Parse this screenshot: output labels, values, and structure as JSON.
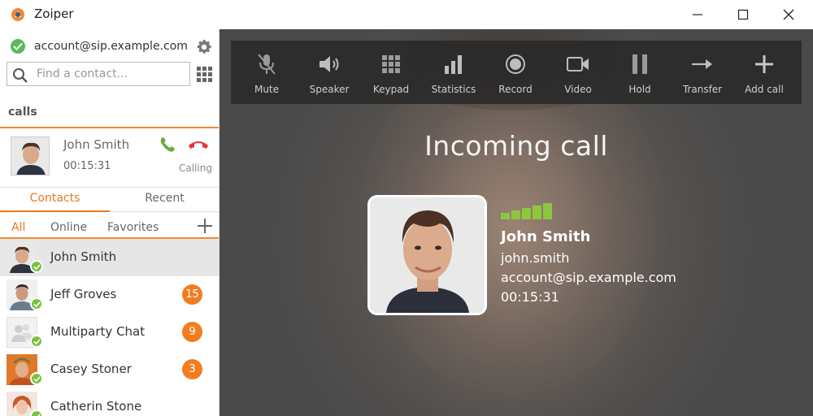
{
  "window": {
    "title": "Zoiper",
    "minimize_icon": "minimize-icon",
    "maximize_icon": "maximize-icon",
    "close_icon": "close-icon"
  },
  "account": {
    "name": "account@sip.example.com",
    "status": "online",
    "status_color": "#5cb85c"
  },
  "search": {
    "placeholder": "Find a contact..."
  },
  "calls_section": {
    "label": "calls",
    "active_call": {
      "name": "John Smith",
      "duration": "00:15:31",
      "status": "Calling"
    }
  },
  "tabs": [
    {
      "label": "Contacts",
      "active": true
    },
    {
      "label": "Recent",
      "active": false
    }
  ],
  "filters": [
    {
      "label": "All",
      "active": true
    },
    {
      "label": "Online",
      "active": false
    },
    {
      "label": "Favorites",
      "active": false
    }
  ],
  "contacts": [
    {
      "name": "John Smith",
      "badge": "",
      "selected": true
    },
    {
      "name": "Jeff Groves",
      "badge": "15",
      "selected": false
    },
    {
      "name": "Multiparty Chat",
      "badge": "9",
      "selected": false
    },
    {
      "name": "Casey Stoner",
      "badge": "3",
      "selected": false
    },
    {
      "name": "Catherin Stone",
      "badge": "",
      "selected": false
    }
  ],
  "toolbar": [
    {
      "label": "Mute",
      "icon": "mute-icon"
    },
    {
      "label": "Speaker",
      "icon": "speaker-icon"
    },
    {
      "label": "Keypad",
      "icon": "keypad-icon"
    },
    {
      "label": "Statistics",
      "icon": "statistics-icon"
    },
    {
      "label": "Record",
      "icon": "record-icon"
    },
    {
      "label": "Video",
      "icon": "video-icon"
    },
    {
      "label": "Hold",
      "icon": "hold-icon"
    },
    {
      "label": "Transfer",
      "icon": "transfer-icon"
    },
    {
      "label": "Add call",
      "icon": "add-call-icon"
    }
  ],
  "incoming": {
    "title": "Incoming call",
    "caller_name": "John Smith",
    "caller_user": "john.smith",
    "caller_account": "account@sip.example.com",
    "duration": "00:15:31",
    "signal_bars": 5,
    "signal_color": "#8dc63f"
  },
  "colors": {
    "accent": "#e87722",
    "badge": "#f07d21",
    "online": "#7ac143",
    "answer": "#6aaa3a",
    "hangup": "#e5333b"
  }
}
